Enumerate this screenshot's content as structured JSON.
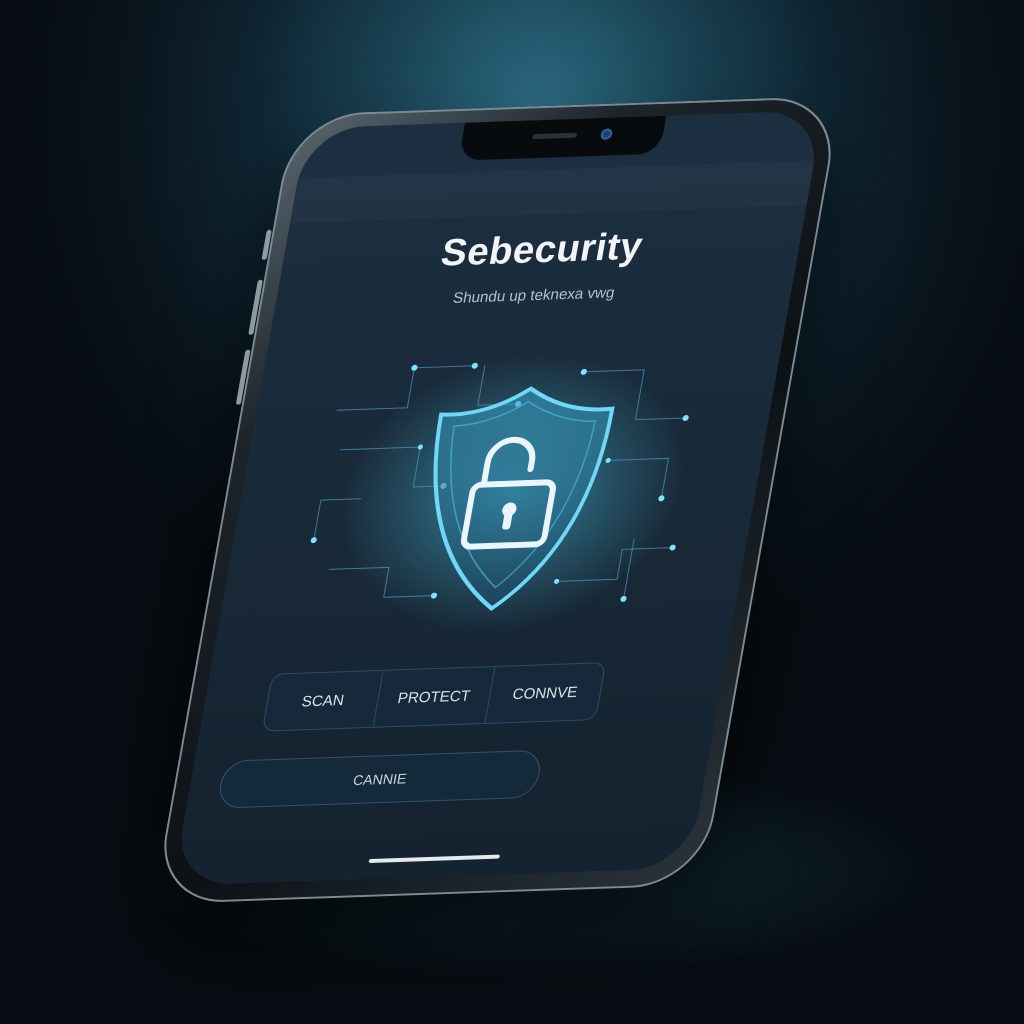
{
  "app": {
    "title": "Sebecurity",
    "subtitle": "Shundu up teknexa vwg"
  },
  "hero": {
    "icon": "shield-lock-icon",
    "label": "Security shield with padlock"
  },
  "tabs": [
    {
      "label": "SCAN"
    },
    {
      "label": "PROTECT"
    },
    {
      "label": "CONNVE"
    }
  ],
  "action_button": {
    "label": "CANNIE"
  },
  "colors": {
    "accent": "#5fd0f0",
    "background": "#0f2633",
    "screen": "#1c2f40"
  }
}
